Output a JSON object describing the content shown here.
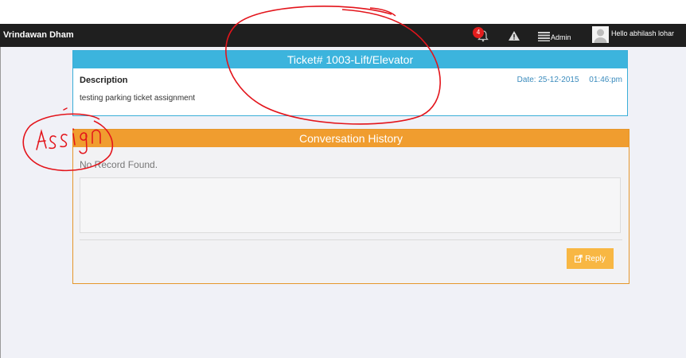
{
  "navbar": {
    "brand": "Vrindawan Dham",
    "notification_count": "4",
    "admin_label": "Admin",
    "user_greeting": "Hello abhilash lohar",
    "icons": [
      "bell-icon",
      "warning-icon",
      "admin-menu-icon",
      "avatar"
    ]
  },
  "ticket": {
    "title": "Ticket# 1003-Lift/Elevator",
    "description_label": "Description",
    "description_text": "testing parking ticket assignment",
    "date_label": "Date: 25-12-2015",
    "time": "01:46:pm"
  },
  "conversation": {
    "title": "Conversation History",
    "empty_text": "No Record Found.",
    "reply_label": "Reply",
    "reply_icon": "share-icon"
  },
  "annotation": {
    "handwritten_text": "Assign",
    "color": "#e3141b"
  },
  "colors": {
    "navbar": "#1f1f1f",
    "ticket_header": "#3cb4dd",
    "conversation_header": "#f09d2f",
    "reply_button": "#f8b743",
    "badge": "#e21d1d",
    "background": "#f0f1f7"
  }
}
